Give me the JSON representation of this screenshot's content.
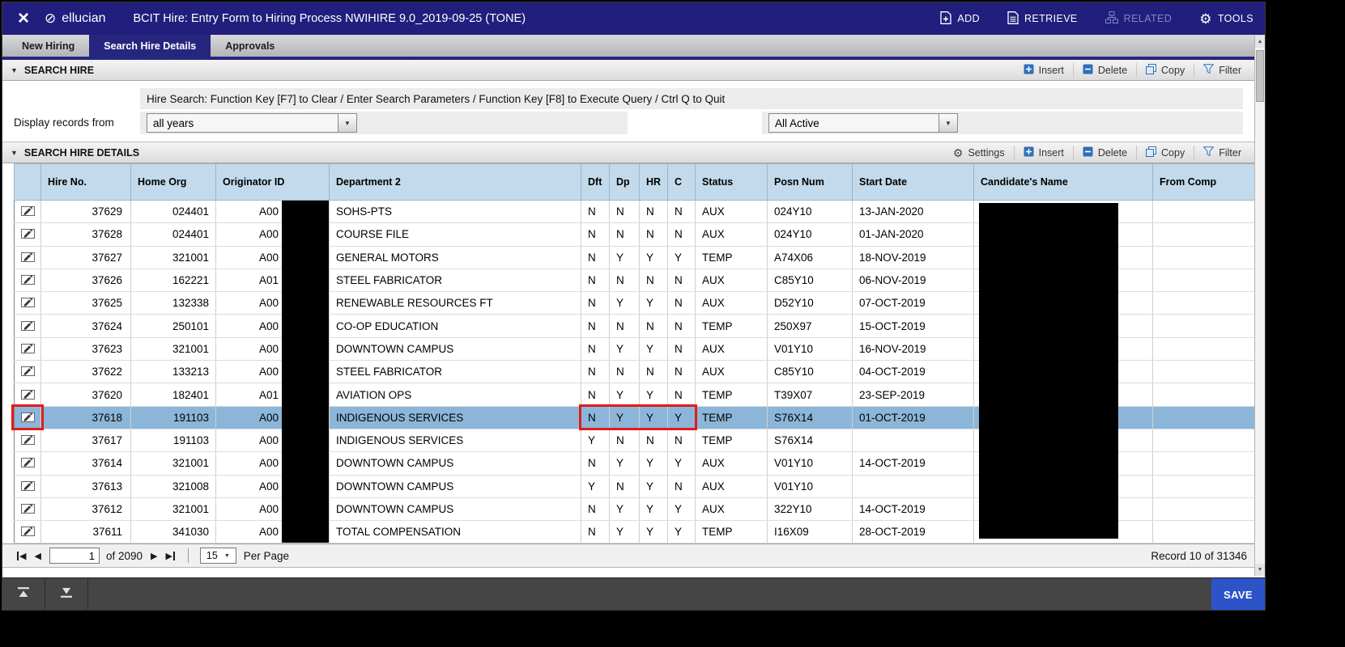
{
  "icons": {
    "close": "×",
    "brand_mark": "⊘",
    "dropdown_arrow": "▼",
    "prev_arrow": "◀",
    "next_arrow": "▶",
    "up_arrow": "▲",
    "down_arrow": "▼",
    "gear": "⚙",
    "collapse": "▼"
  },
  "colors": {
    "titlebar": "#211e7d",
    "active_tab": "#26267e",
    "table_header": "#c2daeb",
    "selected_row": "#8cb6d9",
    "highlight_red": "#e21b1b",
    "save_blue": "#2d53c9",
    "redaction": "#000000"
  },
  "titlebar": {
    "brand": "ellucian",
    "title": "BCIT Hire: Entry Form to Hiring Process NWIHIRE 9.0_2019-09-25 (TONE)",
    "actions": [
      {
        "label": "ADD"
      },
      {
        "label": "RETRIEVE"
      },
      {
        "label": "RELATED"
      },
      {
        "label": "TOOLS"
      }
    ]
  },
  "tabs": [
    {
      "label": "New Hiring"
    },
    {
      "label": "Search Hire Details"
    },
    {
      "label": "Approvals"
    }
  ],
  "search_hire": {
    "section_title": "SEARCH HIRE",
    "toolbar": [
      "Insert",
      "Delete",
      "Copy",
      "Filter"
    ],
    "hint": "Hire Search: Function Key [F7] to Clear / Enter Search Parameters / Function Key [F8] to Execute Query / Ctrl Q to Quit",
    "display_records_label": "Display records from",
    "years_value": "all years",
    "active_value": "All Active"
  },
  "details": {
    "section_title": "SEARCH HIRE DETAILS",
    "toolbar": [
      "Settings",
      "Insert",
      "Delete",
      "Copy",
      "Filter"
    ],
    "columns": [
      "",
      "Hire No.",
      "Home Org",
      "Originator ID",
      "Department 2",
      "Dft",
      "Dp",
      "HR",
      "C",
      "Status",
      "Posn Num",
      "Start Date",
      "Candidate's Name",
      "From Comp"
    ],
    "rows": [
      {
        "hire_no": "37629",
        "home_org": "024401",
        "originator": "A00",
        "department": "SOHS-PTS",
        "dft": "N",
        "dp": "N",
        "hr": "N",
        "c": "N",
        "status": "AUX",
        "posn_num": "024Y10",
        "start_date": "13-JAN-2020"
      },
      {
        "hire_no": "37628",
        "home_org": "024401",
        "originator": "A00",
        "department": "COURSE FILE",
        "dft": "N",
        "dp": "N",
        "hr": "N",
        "c": "N",
        "status": "AUX",
        "posn_num": "024Y10",
        "start_date": "01-JAN-2020"
      },
      {
        "hire_no": "37627",
        "home_org": "321001",
        "originator": "A00",
        "department": "GENERAL MOTORS",
        "dft": "N",
        "dp": "Y",
        "hr": "Y",
        "c": "Y",
        "status": "TEMP",
        "posn_num": "A74X06",
        "start_date": "18-NOV-2019"
      },
      {
        "hire_no": "37626",
        "home_org": "162221",
        "originator": "A01",
        "department": "STEEL FABRICATOR",
        "dft": "N",
        "dp": "N",
        "hr": "N",
        "c": "N",
        "status": "AUX",
        "posn_num": "C85Y10",
        "start_date": "06-NOV-2019"
      },
      {
        "hire_no": "37625",
        "home_org": "132338",
        "originator": "A00",
        "department": "RENEWABLE RESOURCES FT",
        "dft": "N",
        "dp": "Y",
        "hr": "Y",
        "c": "N",
        "status": "AUX",
        "posn_num": "D52Y10",
        "start_date": "07-OCT-2019"
      },
      {
        "hire_no": "37624",
        "home_org": "250101",
        "originator": "A00",
        "department": "CO-OP EDUCATION",
        "dft": "N",
        "dp": "N",
        "hr": "N",
        "c": "N",
        "status": "TEMP",
        "posn_num": "250X97",
        "start_date": "15-OCT-2019"
      },
      {
        "hire_no": "37623",
        "home_org": "321001",
        "originator": "A00",
        "department": "DOWNTOWN CAMPUS",
        "dft": "N",
        "dp": "Y",
        "hr": "Y",
        "c": "N",
        "status": "AUX",
        "posn_num": "V01Y10",
        "start_date": "16-NOV-2019"
      },
      {
        "hire_no": "37622",
        "home_org": "133213",
        "originator": "A00",
        "department": "STEEL FABRICATOR",
        "dft": "N",
        "dp": "N",
        "hr": "N",
        "c": "N",
        "status": "AUX",
        "posn_num": "C85Y10",
        "start_date": "04-OCT-2019"
      },
      {
        "hire_no": "37620",
        "home_org": "182401",
        "originator": "A01",
        "department": "AVIATION OPS",
        "dft": "N",
        "dp": "Y",
        "hr": "Y",
        "c": "N",
        "status": "TEMP",
        "posn_num": "T39X07",
        "start_date": "23-SEP-2019"
      },
      {
        "hire_no": "37618",
        "home_org": "191103",
        "originator": "A00",
        "department": "INDIGENOUS SERVICES",
        "dft": "N",
        "dp": "Y",
        "hr": "Y",
        "c": "Y",
        "status": "TEMP",
        "posn_num": "S76X14",
        "start_date": "01-OCT-2019",
        "selected": true
      },
      {
        "hire_no": "37617",
        "home_org": "191103",
        "originator": "A00",
        "department": "INDIGENOUS SERVICES",
        "dft": "Y",
        "dp": "N",
        "hr": "N",
        "c": "N",
        "status": "TEMP",
        "posn_num": "S76X14",
        "start_date": ""
      },
      {
        "hire_no": "37614",
        "home_org": "321001",
        "originator": "A00",
        "department": "DOWNTOWN CAMPUS",
        "dft": "N",
        "dp": "Y",
        "hr": "Y",
        "c": "Y",
        "status": "AUX",
        "posn_num": "V01Y10",
        "start_date": "14-OCT-2019"
      },
      {
        "hire_no": "37613",
        "home_org": "321008",
        "originator": "A00",
        "department": "DOWNTOWN CAMPUS",
        "dft": "Y",
        "dp": "N",
        "hr": "Y",
        "c": "N",
        "status": "AUX",
        "posn_num": "V01Y10",
        "start_date": ""
      },
      {
        "hire_no": "37612",
        "home_org": "321001",
        "originator": "A00",
        "department": "DOWNTOWN CAMPUS",
        "dft": "N",
        "dp": "Y",
        "hr": "Y",
        "c": "Y",
        "status": "AUX",
        "posn_num": "322Y10",
        "start_date": "14-OCT-2019"
      },
      {
        "hire_no": "37611",
        "home_org": "341030",
        "originator": "A00",
        "department": "TOTAL COMPENSATION",
        "dft": "N",
        "dp": "Y",
        "hr": "Y",
        "c": "Y",
        "status": "TEMP",
        "posn_num": "I16X09",
        "start_date": "28-OCT-2019"
      }
    ]
  },
  "pagination": {
    "page_value": "1",
    "of_label": "of 2090",
    "per_page_value": "15",
    "per_page_label": "Per Page",
    "record_label": "Record 10 of 31346"
  },
  "footer": {
    "save_label": "SAVE"
  }
}
